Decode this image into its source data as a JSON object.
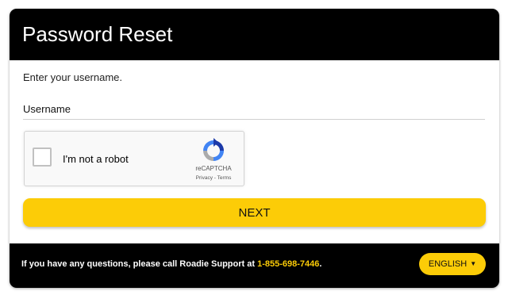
{
  "header": {
    "title": "Password Reset"
  },
  "form": {
    "instructions": "Enter your username.",
    "username_label": "Username",
    "username_value": ""
  },
  "recaptcha": {
    "label": "I'm not a robot",
    "brand": "reCAPTCHA",
    "links": "Privacy - Terms",
    "checked": false
  },
  "actions": {
    "next_label": "NEXT"
  },
  "footer": {
    "support_text": "If you have any questions, please call Roadie Support at ",
    "phone": "1-855-698-7446",
    "period": ".",
    "language_label": "ENGLISH",
    "language_icon": "caret-down-icon"
  },
  "colors": {
    "accent": "#fccc07",
    "header_bg": "#000000",
    "footer_bg": "#000000"
  }
}
